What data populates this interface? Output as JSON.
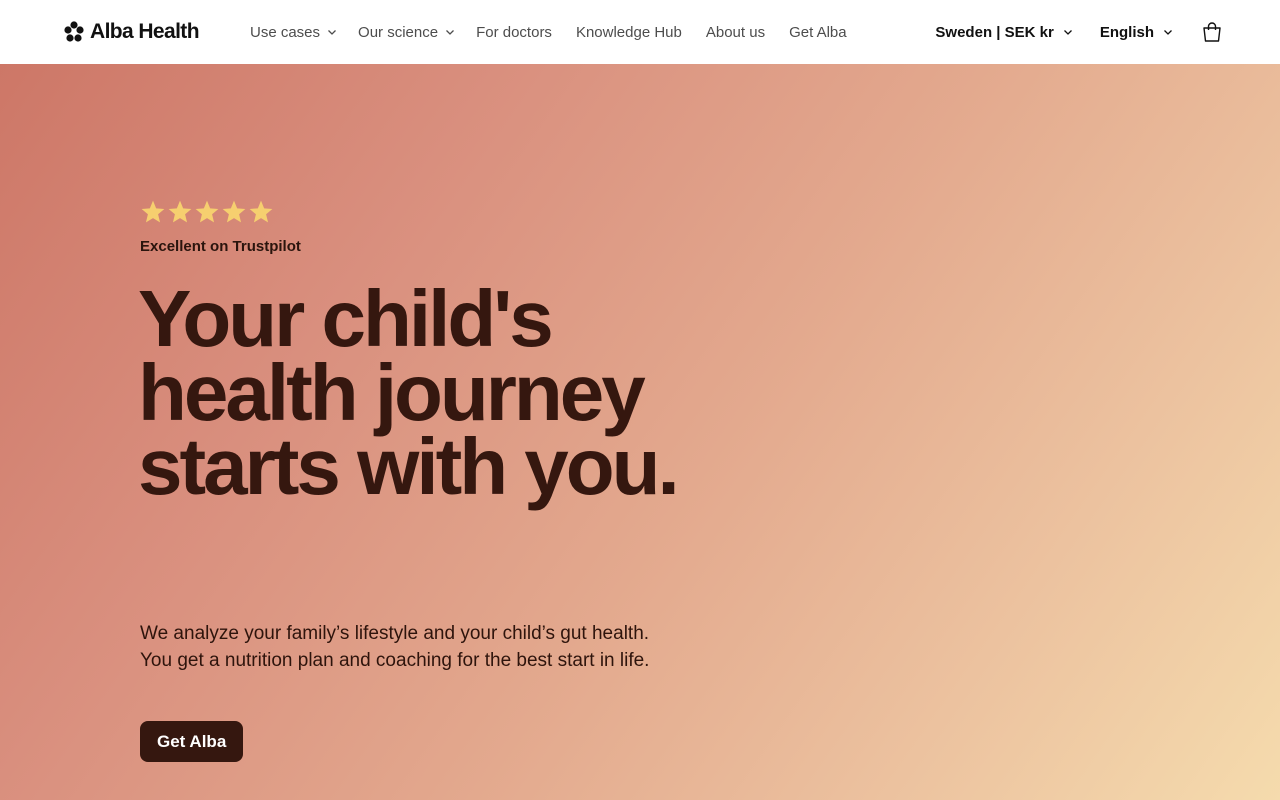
{
  "header": {
    "logo_text": "Alba Health",
    "nav": [
      {
        "label": "Use cases",
        "dropdown": true
      },
      {
        "label": "Our science",
        "dropdown": true
      },
      {
        "label": "For doctors",
        "dropdown": false
      },
      {
        "label": "Knowledge Hub",
        "dropdown": false
      },
      {
        "label": "About us",
        "dropdown": false
      },
      {
        "label": "Get Alba",
        "dropdown": false
      }
    ],
    "region_label": "Sweden | SEK kr",
    "language_label": "English",
    "cart_icon": "cart-icon"
  },
  "hero": {
    "rating_stars": 5,
    "rating_label": "Excellent on Trustpilot",
    "title": "Your child's health journey starts with you.",
    "description": "We analyze your family’s lifestyle and your child’s gut health. You get a nutrition plan and coaching for the best start in life.",
    "cta_label": "Get Alba"
  },
  "colors": {
    "text_dark": "#35170f",
    "star": "#f6cf6f",
    "gradient_start": "#cd7767",
    "gradient_end": "#f5dbad",
    "cta_bg": "#35170f"
  }
}
